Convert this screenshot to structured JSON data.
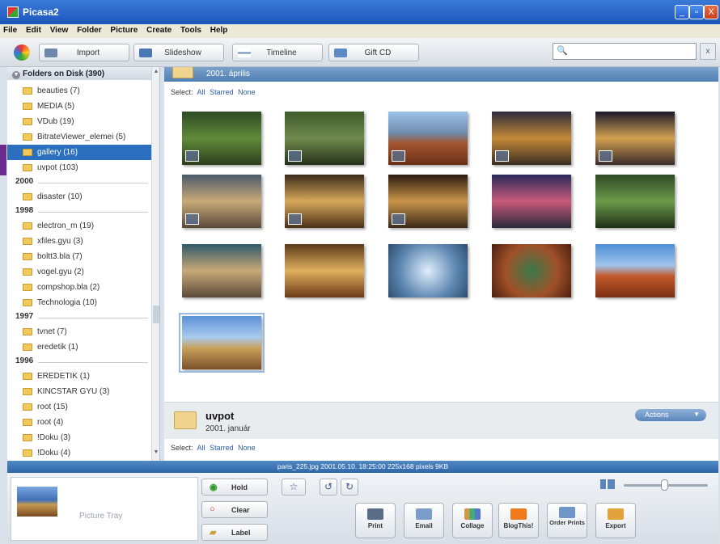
{
  "window": {
    "title": "Picasa2",
    "min": "_",
    "max": "▫",
    "close": "X"
  },
  "menu": [
    "File",
    "Edit",
    "View",
    "Folder",
    "Picture",
    "Create",
    "Tools",
    "Help"
  ],
  "toolbar": {
    "import": "Import",
    "slideshow": "Slideshow",
    "timeline": "Timeline",
    "giftcd": "Gift CD"
  },
  "search": {
    "value": "",
    "icon": "🔍",
    "clear": "x"
  },
  "sidebar": {
    "header": "Folders on Disk (390)",
    "groups": [
      {
        "year": "",
        "items": [
          "beauties (7)",
          "MEDIA (5)",
          "VDub (19)",
          "BitrateViewer_elemei (5)",
          "gallery (16)",
          "uvpot (103)"
        ]
      },
      {
        "year": "2000",
        "items": [
          "disaster (10)"
        ]
      },
      {
        "year": "1998",
        "items": [
          "electron_m (19)",
          "xfiles.gyu (3)",
          "boltt3.bla (7)",
          "vogel.gyu (2)",
          "compshop.bla (2)",
          "Technologia (10)"
        ]
      },
      {
        "year": "1997",
        "items": [
          "tvnet (7)",
          "eredetik (1)"
        ]
      },
      {
        "year": "1996",
        "items": [
          "EREDETIK (1)",
          "KINCSTAR GYU (3)",
          "root (15)",
          "root (4)",
          "!Doku (3)",
          "!Doku (4)"
        ]
      }
    ],
    "selected": "gallery (16)"
  },
  "album": {
    "date": "2001. április",
    "select": {
      "label": "Select:",
      "all": "All",
      "starred": "Starred",
      "none": "None"
    },
    "photo_count": 16
  },
  "album2": {
    "name": "uvpot",
    "date": "2001. január",
    "actions": "Actions"
  },
  "status": "paris_225.jpg    2001.05.10. 18:25:00    225x168 pixels    9KB",
  "bottom": {
    "tray": "Picture Tray",
    "hold": "Hold",
    "clear": "Clear",
    "label": "Label",
    "actions": [
      "Print",
      "Email",
      "Collage",
      "BlogThis!",
      "Order Prints",
      "Export"
    ]
  },
  "colors": {
    "accent": "#2b6fbe",
    "statusbar": "#3d74b4"
  }
}
